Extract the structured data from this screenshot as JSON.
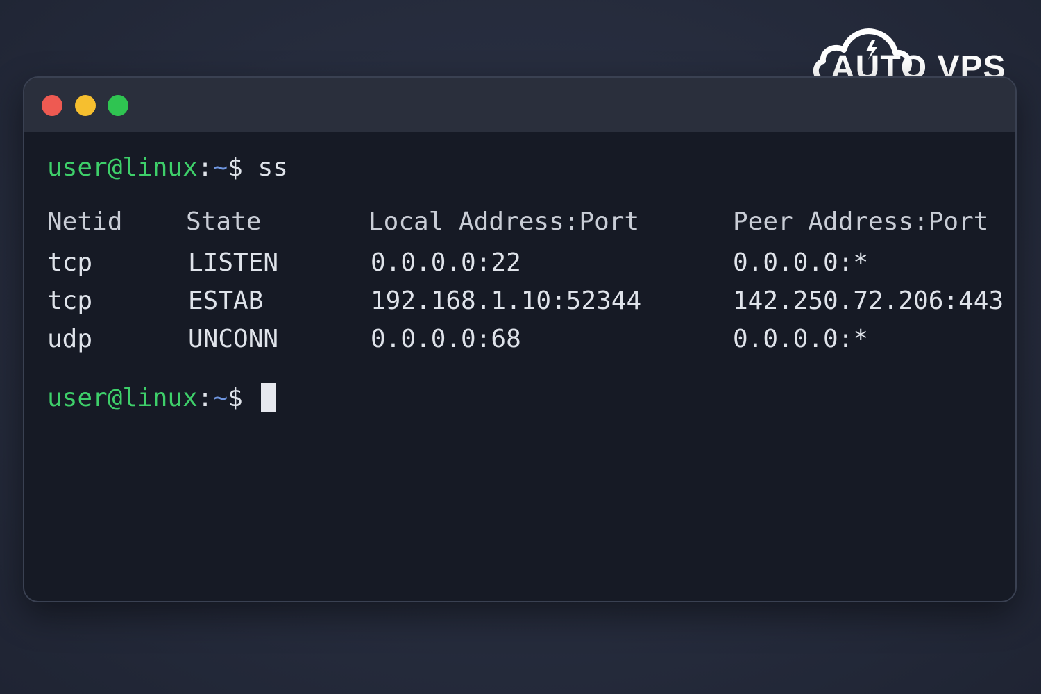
{
  "logo": {
    "text": "AUTO VPS",
    "icon": "cloud-bolt-icon"
  },
  "window": {
    "controls": {
      "close_color": "#ee5a52",
      "minimize_color": "#f6bf2f",
      "zoom_color": "#2fc451"
    }
  },
  "terminal": {
    "colors": {
      "user_host": "#3ecf6a",
      "path": "#6f96e0",
      "text": "#dfe3ea"
    },
    "prompt": {
      "user_host": "user@linux",
      "colon": ":",
      "path": "~",
      "symbol": "$"
    },
    "command": "ss",
    "table": {
      "headers": [
        "Netid",
        "State",
        "Local Address:Port",
        "Peer Address:Port"
      ],
      "rows": [
        [
          "tcp",
          "LISTEN",
          "0.0.0.0:22",
          "0.0.0.0:*"
        ],
        [
          "tcp",
          "ESTAB",
          "192.168.1.10:52344",
          "142.250.72.206:443"
        ],
        [
          "udp",
          "UNCONN",
          "0.0.0.0:68",
          "0.0.0.0:*"
        ]
      ]
    }
  }
}
